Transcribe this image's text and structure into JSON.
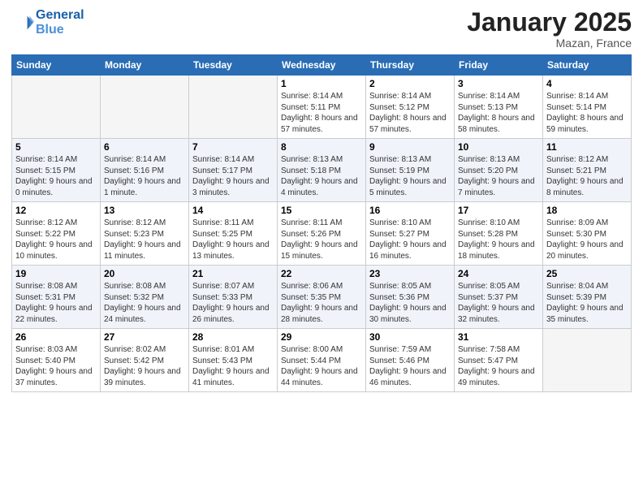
{
  "header": {
    "logo_line1": "General",
    "logo_line2": "Blue",
    "month": "January 2025",
    "location": "Mazan, France"
  },
  "days_of_week": [
    "Sunday",
    "Monday",
    "Tuesday",
    "Wednesday",
    "Thursday",
    "Friday",
    "Saturday"
  ],
  "weeks": [
    [
      {
        "day": "",
        "info": ""
      },
      {
        "day": "",
        "info": ""
      },
      {
        "day": "",
        "info": ""
      },
      {
        "day": "1",
        "info": "Sunrise: 8:14 AM\nSunset: 5:11 PM\nDaylight: 8 hours\nand 57 minutes."
      },
      {
        "day": "2",
        "info": "Sunrise: 8:14 AM\nSunset: 5:12 PM\nDaylight: 8 hours\nand 57 minutes."
      },
      {
        "day": "3",
        "info": "Sunrise: 8:14 AM\nSunset: 5:13 PM\nDaylight: 8 hours\nand 58 minutes."
      },
      {
        "day": "4",
        "info": "Sunrise: 8:14 AM\nSunset: 5:14 PM\nDaylight: 8 hours\nand 59 minutes."
      }
    ],
    [
      {
        "day": "5",
        "info": "Sunrise: 8:14 AM\nSunset: 5:15 PM\nDaylight: 9 hours\nand 0 minutes."
      },
      {
        "day": "6",
        "info": "Sunrise: 8:14 AM\nSunset: 5:16 PM\nDaylight: 9 hours\nand 1 minute."
      },
      {
        "day": "7",
        "info": "Sunrise: 8:14 AM\nSunset: 5:17 PM\nDaylight: 9 hours\nand 3 minutes."
      },
      {
        "day": "8",
        "info": "Sunrise: 8:13 AM\nSunset: 5:18 PM\nDaylight: 9 hours\nand 4 minutes."
      },
      {
        "day": "9",
        "info": "Sunrise: 8:13 AM\nSunset: 5:19 PM\nDaylight: 9 hours\nand 5 minutes."
      },
      {
        "day": "10",
        "info": "Sunrise: 8:13 AM\nSunset: 5:20 PM\nDaylight: 9 hours\nand 7 minutes."
      },
      {
        "day": "11",
        "info": "Sunrise: 8:12 AM\nSunset: 5:21 PM\nDaylight: 9 hours\nand 8 minutes."
      }
    ],
    [
      {
        "day": "12",
        "info": "Sunrise: 8:12 AM\nSunset: 5:22 PM\nDaylight: 9 hours\nand 10 minutes."
      },
      {
        "day": "13",
        "info": "Sunrise: 8:12 AM\nSunset: 5:23 PM\nDaylight: 9 hours\nand 11 minutes."
      },
      {
        "day": "14",
        "info": "Sunrise: 8:11 AM\nSunset: 5:25 PM\nDaylight: 9 hours\nand 13 minutes."
      },
      {
        "day": "15",
        "info": "Sunrise: 8:11 AM\nSunset: 5:26 PM\nDaylight: 9 hours\nand 15 minutes."
      },
      {
        "day": "16",
        "info": "Sunrise: 8:10 AM\nSunset: 5:27 PM\nDaylight: 9 hours\nand 16 minutes."
      },
      {
        "day": "17",
        "info": "Sunrise: 8:10 AM\nSunset: 5:28 PM\nDaylight: 9 hours\nand 18 minutes."
      },
      {
        "day": "18",
        "info": "Sunrise: 8:09 AM\nSunset: 5:30 PM\nDaylight: 9 hours\nand 20 minutes."
      }
    ],
    [
      {
        "day": "19",
        "info": "Sunrise: 8:08 AM\nSunset: 5:31 PM\nDaylight: 9 hours\nand 22 minutes."
      },
      {
        "day": "20",
        "info": "Sunrise: 8:08 AM\nSunset: 5:32 PM\nDaylight: 9 hours\nand 24 minutes."
      },
      {
        "day": "21",
        "info": "Sunrise: 8:07 AM\nSunset: 5:33 PM\nDaylight: 9 hours\nand 26 minutes."
      },
      {
        "day": "22",
        "info": "Sunrise: 8:06 AM\nSunset: 5:35 PM\nDaylight: 9 hours\nand 28 minutes."
      },
      {
        "day": "23",
        "info": "Sunrise: 8:05 AM\nSunset: 5:36 PM\nDaylight: 9 hours\nand 30 minutes."
      },
      {
        "day": "24",
        "info": "Sunrise: 8:05 AM\nSunset: 5:37 PM\nDaylight: 9 hours\nand 32 minutes."
      },
      {
        "day": "25",
        "info": "Sunrise: 8:04 AM\nSunset: 5:39 PM\nDaylight: 9 hours\nand 35 minutes."
      }
    ],
    [
      {
        "day": "26",
        "info": "Sunrise: 8:03 AM\nSunset: 5:40 PM\nDaylight: 9 hours\nand 37 minutes."
      },
      {
        "day": "27",
        "info": "Sunrise: 8:02 AM\nSunset: 5:42 PM\nDaylight: 9 hours\nand 39 minutes."
      },
      {
        "day": "28",
        "info": "Sunrise: 8:01 AM\nSunset: 5:43 PM\nDaylight: 9 hours\nand 41 minutes."
      },
      {
        "day": "29",
        "info": "Sunrise: 8:00 AM\nSunset: 5:44 PM\nDaylight: 9 hours\nand 44 minutes."
      },
      {
        "day": "30",
        "info": "Sunrise: 7:59 AM\nSunset: 5:46 PM\nDaylight: 9 hours\nand 46 minutes."
      },
      {
        "day": "31",
        "info": "Sunrise: 7:58 AM\nSunset: 5:47 PM\nDaylight: 9 hours\nand 49 minutes."
      },
      {
        "day": "",
        "info": ""
      }
    ]
  ]
}
